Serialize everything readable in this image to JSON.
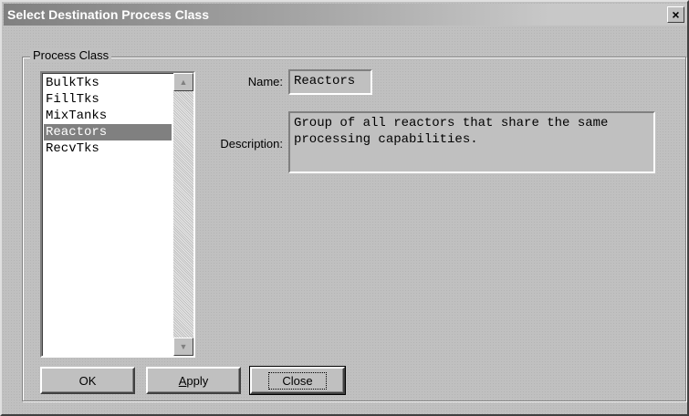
{
  "window": {
    "title": "Select Destination Process Class",
    "close_glyph": "×"
  },
  "group": {
    "legend": "Process Class"
  },
  "list": {
    "items": [
      "BulkTks",
      "FillTks",
      "MixTanks",
      "Reactors",
      "RecvTks"
    ],
    "selected_index": 3,
    "scroll_up_glyph": "▲",
    "scroll_down_glyph": "▼"
  },
  "details": {
    "name_label": "Name:",
    "name_value": "Reactors",
    "description_label": "Description:",
    "description_value": "Group of all reactors that share the same processing capabilities."
  },
  "buttons": {
    "ok_label": "OK",
    "apply_prefix": "A",
    "apply_rest": "pply",
    "close_label": "Close"
  }
}
